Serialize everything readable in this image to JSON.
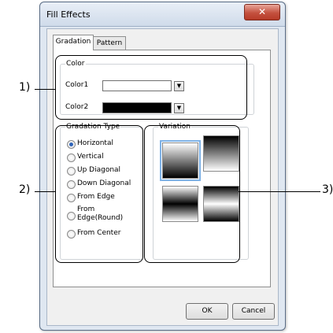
{
  "window": {
    "title": "Fill Effects",
    "close_glyph": "✕"
  },
  "tabs": [
    "Gradation",
    "Pattern"
  ],
  "color_group": {
    "legend": "Color",
    "color1_label": "Color1",
    "color2_label": "Color2",
    "color1_value": "#ffffff",
    "color2_value": "#000000",
    "dropdown_icon": "▼"
  },
  "gradation_type": {
    "legend": "Gradation Type",
    "options": [
      "Horizontal",
      "Vertical",
      "Up Diagonal",
      "Down Diagonal",
      "From Edge",
      "From",
      "Edge(Round)",
      "From Center"
    ],
    "selected_index": 0
  },
  "variation": {
    "legend": "Variation",
    "selected_index": 0
  },
  "buttons": {
    "ok": "OK",
    "cancel": "Cancel"
  },
  "callouts": {
    "one": "1)",
    "two": "2)",
    "three": "3)"
  }
}
